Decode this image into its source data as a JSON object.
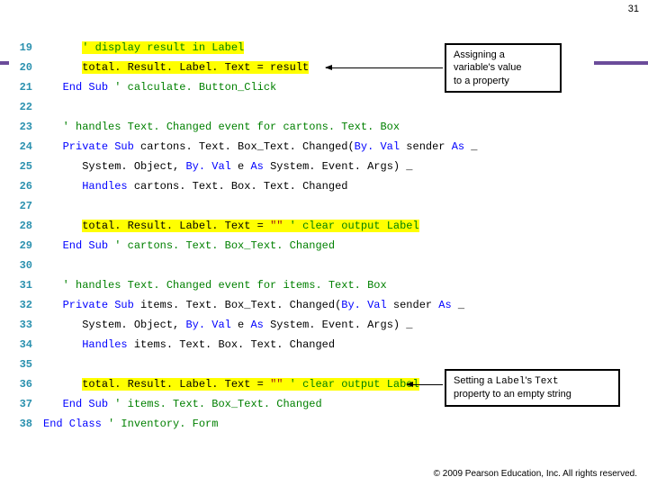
{
  "slide_number": "31",
  "callouts": {
    "c1": {
      "l1": "Assigning a",
      "l2": "variable's value",
      "l3": "to a property"
    },
    "c2": {
      "l1": "Setting a ",
      "l1m": "Label",
      "l1b": "'s ",
      "l1c": "Text",
      "l2": "property to an empty string"
    }
  },
  "code": {
    "19": {
      "pre": "      ",
      "c": "' display result in Label"
    },
    "20": {
      "pre": "      ",
      "t": "total. Result. Label. Text = result"
    },
    "21": {
      "pre": "   ",
      "k": "End Sub",
      "c": " ' calculate. Button_Click"
    },
    "22": {
      "pre": "",
      "t": ""
    },
    "23": {
      "pre": "   ",
      "c": "' handles Text. Changed event for cartons. Text. Box"
    },
    "24": {
      "pre": "   ",
      "k1": "Private Sub",
      "t1": " cartons. Text. Box_Text. Changed(",
      "k2": "By. Val",
      "t2": " sender ",
      "k3": "As",
      "t3": " _"
    },
    "25": {
      "pre": "      ",
      "t1": "System. Object, ",
      "k1": "By. Val",
      "t2": " e ",
      "k2": "As",
      "t3": " System. Event. Args) _"
    },
    "26": {
      "pre": "      ",
      "k": "Handles",
      "t": " cartons. Text. Box. Text. Changed"
    },
    "27": {
      "pre": "",
      "t": ""
    },
    "28": {
      "pre": "      ",
      "t1": "total. Result. Label. Text = ",
      "s": "\"\"",
      "c": " ' clear output Label"
    },
    "29": {
      "pre": "   ",
      "k": "End Sub",
      "c": " ' cartons. Text. Box_Text. Changed"
    },
    "30": {
      "pre": "",
      "t": ""
    },
    "31": {
      "pre": "   ",
      "c": "' handles Text. Changed event for items. Text. Box"
    },
    "32": {
      "pre": "   ",
      "k1": "Private Sub",
      "t1": " items. Text. Box_Text. Changed(",
      "k2": "By. Val",
      "t2": " sender ",
      "k3": "As",
      "t3": " _"
    },
    "33": {
      "pre": "      ",
      "t1": "System. Object, ",
      "k1": "By. Val",
      "t2": " e ",
      "k2": "As",
      "t3": " System. Event. Args) _"
    },
    "34": {
      "pre": "      ",
      "k": "Handles",
      "t": " items. Text. Box. Text. Changed"
    },
    "35": {
      "pre": "",
      "t": ""
    },
    "36": {
      "pre": "      ",
      "t1": "total. Result. Label. Text = ",
      "s": "\"\"",
      "c": " ' clear output Label"
    },
    "37": {
      "pre": "   ",
      "k": "End Sub",
      "c": " ' items. Text. Box_Text. Changed"
    },
    "38": {
      "pre": "",
      "k": "End Class",
      "c": " ' Inventory. Form"
    }
  },
  "footer": "© 2009 Pearson Education, Inc.  All rights reserved."
}
